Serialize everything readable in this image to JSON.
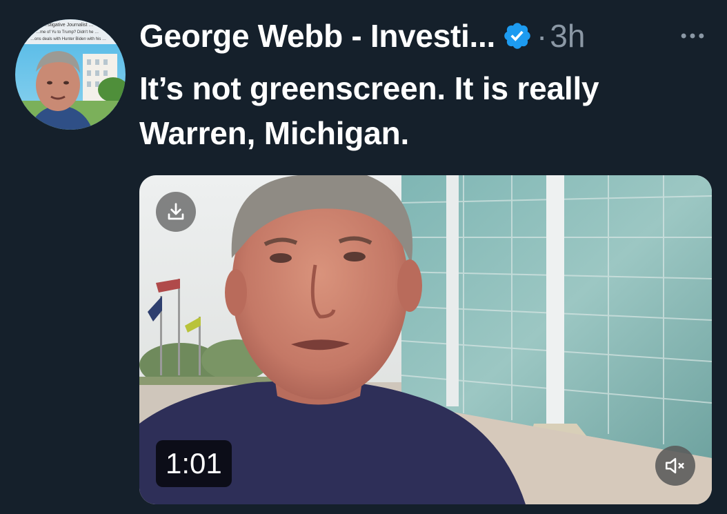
{
  "tweet": {
    "author_name": "George Webb - Investi...",
    "timestamp": "3h",
    "separator": "·",
    "text_line1": "It’s not greenscreen. It is really",
    "text_line2": "Warren, Michigan."
  },
  "avatar": {
    "caption_lines": [
      "…stigative Journalist …",
      "…me of Yu to Trump? Didn't he …",
      "…ons deals with Hunter Biden with his …"
    ]
  },
  "media": {
    "duration": "1:01"
  },
  "icons": {
    "verified": "verified-badge-icon",
    "more": "more-horizontal-icon",
    "download": "download-icon",
    "mute": "muted-speaker-icon"
  },
  "colors": {
    "background": "#15202b",
    "primary_text": "#ffffff",
    "secondary_text": "#8b98a5",
    "verified_blue": "#1d9bf0"
  }
}
